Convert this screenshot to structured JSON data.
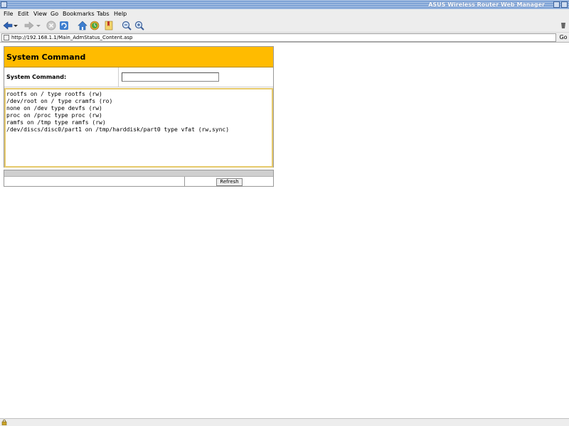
{
  "window": {
    "title": "ASUS Wireless Router Web Manager"
  },
  "menubar": {
    "items": [
      "File",
      "Edit",
      "View",
      "Go",
      "Bookmarks",
      "Tabs",
      "Help"
    ]
  },
  "toolbar": {
    "icons": [
      "back-icon",
      "back-dropdown-icon",
      "forward-icon",
      "forward-dropdown-icon",
      "stop-icon",
      "reload-icon",
      "home-icon",
      "history-icon",
      "bookmarks-icon",
      "zoom-out-icon",
      "zoom-in-icon"
    ]
  },
  "address": {
    "url": "http://192.168.1.1/Main_AdmStatus_Content.asp",
    "go_label": "Go"
  },
  "page": {
    "header": "System Command",
    "command_label": "System Command:",
    "command_value": "",
    "output_lines": [
      "rootfs on / type rootfs (rw)",
      "/dev/root on / type cramfs (ro)",
      "none on /dev type devfs (rw)",
      "proc on /proc type proc (rw)",
      "ramfs on /tmp type ramfs (rw)",
      "/dev/discs/disc0/part1 on /tmp/harddisk/part0 type vfat (rw,sync)"
    ],
    "refresh_label": "Refresh"
  },
  "colors": {
    "header_bg": "#ffbb00",
    "output_border": "#e6c96b",
    "titlebar": "#7fa3d6"
  }
}
